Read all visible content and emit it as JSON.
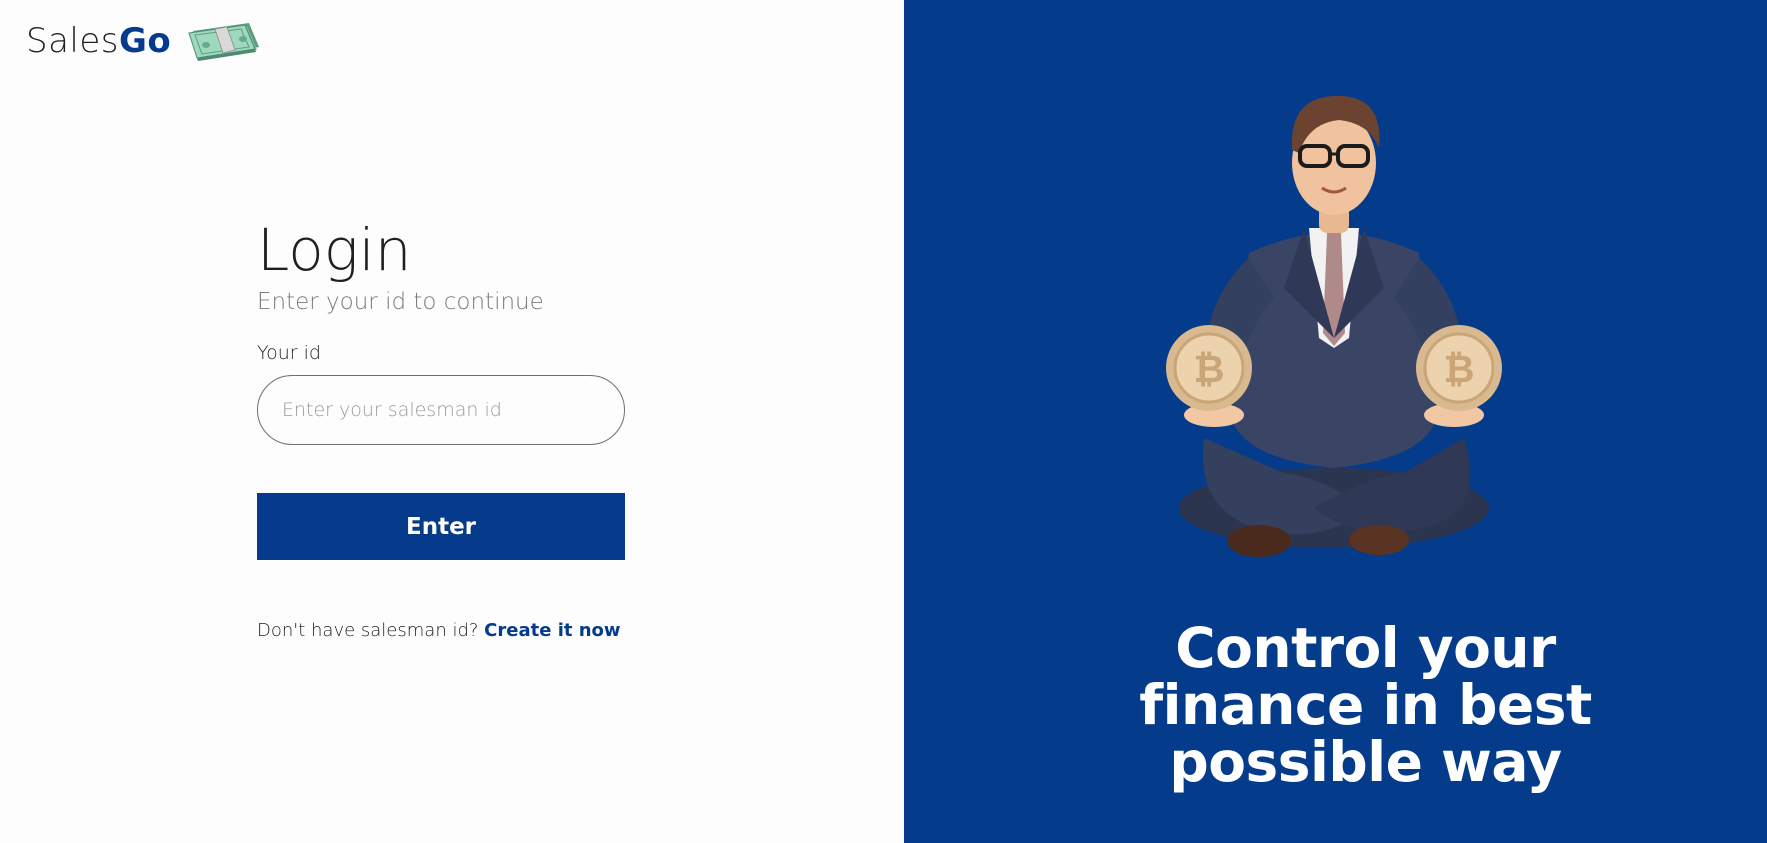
{
  "brand": {
    "name_prefix": "Sales",
    "name_suffix": "Go",
    "icon": "money-stack-icon"
  },
  "login": {
    "title": "Login",
    "subtitle": "Enter your id to continue",
    "field_label": "Your id",
    "input_placeholder": "Enter your salesman id",
    "input_value": "",
    "submit_label": "Enter",
    "signup_prompt": "Don't have salesman id?",
    "signup_link": "Create it now"
  },
  "promo": {
    "illustration": "meditating-businessman-with-bitcoins",
    "tagline_lines": [
      "Control your",
      "finance in best",
      "possible way"
    ]
  },
  "colors": {
    "accent": "#053b8a",
    "panel_bg": "#043b8a",
    "page_bg": "#fdfdfd"
  }
}
